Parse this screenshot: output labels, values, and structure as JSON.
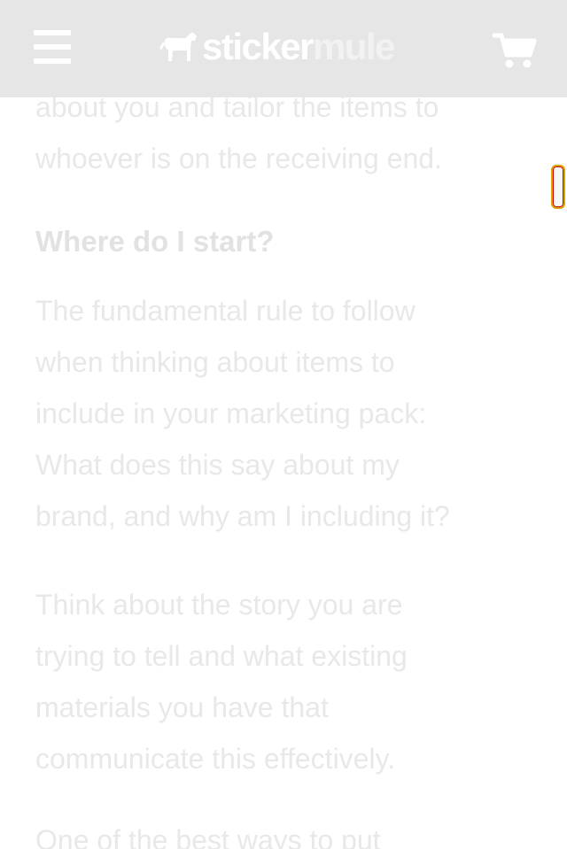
{
  "header": {
    "logo_part1": "sticker",
    "logo_part2": "mule",
    "colors": {
      "bar": "#e6e6e6",
      "icons": "#ffffff"
    },
    "icons": {
      "menu": "hamburger-menu-icon",
      "logo": "mule-icon",
      "cart": "cart-icon"
    }
  },
  "article": {
    "para_top_line1": "about you and tailor the items to",
    "para_top_line2": "whoever is on the receiving end.",
    "heading": "Where do I start?",
    "para2": [
      "The fundamental rule to follow",
      "when thinking about items to",
      "include in your marketing pack:",
      "What does this say about my",
      "brand, and why am I including it?"
    ],
    "para3": [
      "Think about the story you are",
      "trying to tell and what existing",
      "materials you have that",
      "communicate this effectively."
    ],
    "para4_partial": "One of the best ways to put"
  }
}
